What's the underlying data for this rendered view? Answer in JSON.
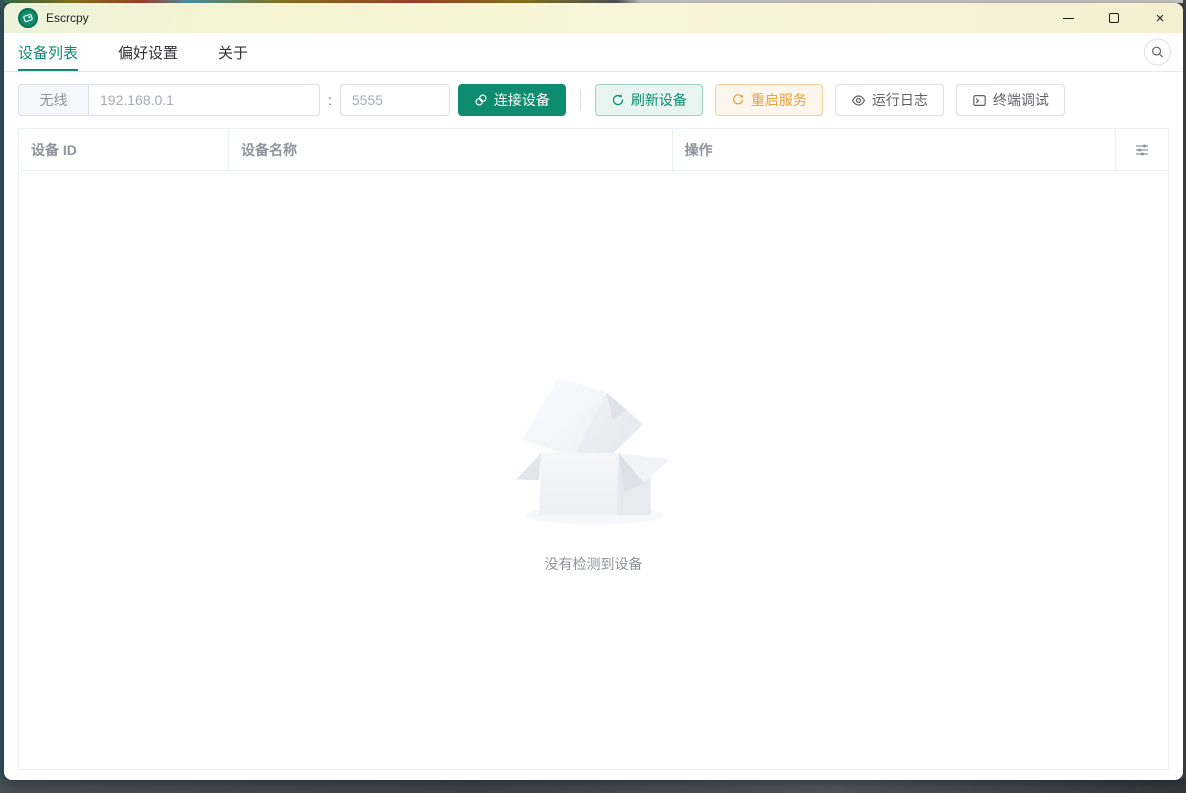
{
  "window": {
    "title": "Escrcpy"
  },
  "tabs": [
    {
      "label": "设备列表",
      "active": true
    },
    {
      "label": "偏好设置",
      "active": false
    },
    {
      "label": "关于",
      "active": false
    }
  ],
  "toolbar": {
    "mode_label": "无线",
    "ip_placeholder": "192.168.0.1",
    "port_separator": ":",
    "port_placeholder": "5555",
    "connect_label": "连接设备",
    "refresh_label": "刷新设备",
    "restart_label": "重启服务",
    "logs_label": "运行日志",
    "terminal_label": "终端调试"
  },
  "table": {
    "columns": [
      "设备 ID",
      "设备名称",
      "操作"
    ]
  },
  "empty": {
    "description": "没有检测到设备"
  },
  "colors": {
    "primary": "#0e8c6f",
    "warning": "#e6a23c",
    "titlebar": "#f6f3d2"
  }
}
